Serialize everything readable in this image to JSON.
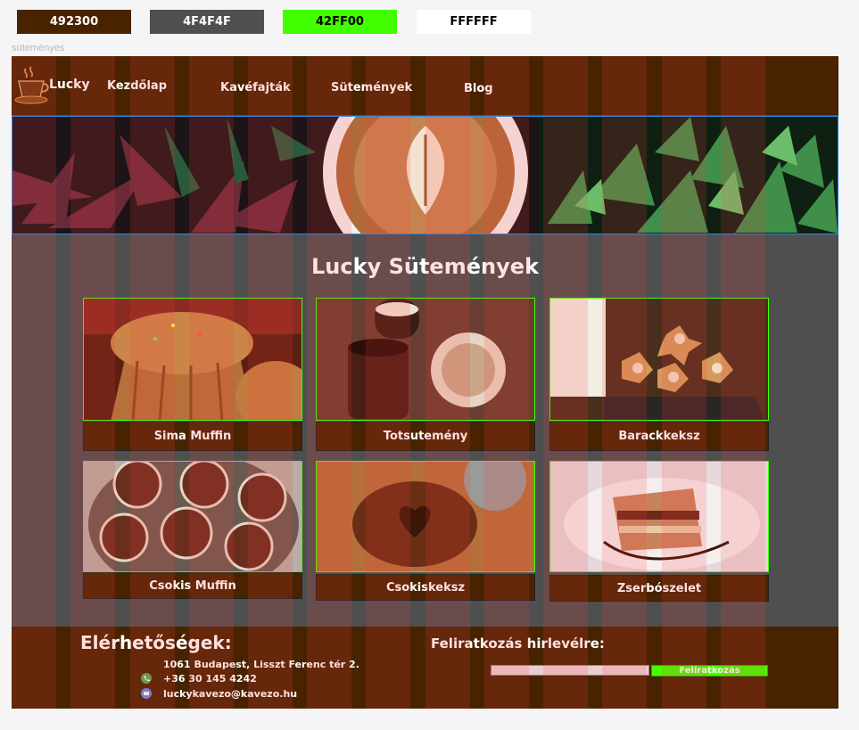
{
  "swatches": [
    {
      "label": "492300",
      "bg": "#492300",
      "fg": "#ffffff"
    },
    {
      "label": "4F4F4F",
      "bg": "#4f4f4f",
      "fg": "#ffffff"
    },
    {
      "label": "42FF00",
      "bg": "#42ff00",
      "fg": "#000000"
    },
    {
      "label": "FFFFFF",
      "bg": "#ffffff",
      "fg": "#000000"
    }
  ],
  "frame_label": "süteményes",
  "header": {
    "brand": "Lucky",
    "nav": [
      "Kezdőlap",
      "Kavéfajták",
      "Sütemények",
      "Blog"
    ]
  },
  "main": {
    "title": "Lucky Sütemények",
    "items": [
      {
        "label": "Sima Muffin",
        "icon": "muffin-photo"
      },
      {
        "label": "Totsutemény",
        "icon": "truffle-cake-photo"
      },
      {
        "label": "Barackkeksz",
        "icon": "star-cookies-photo"
      },
      {
        "label": "Csokis Muffin",
        "icon": "chocolate-muffins-photo"
      },
      {
        "label": "Csokiskeksz",
        "icon": "chocolate-cookie-photo"
      },
      {
        "label": "Zserbószelet",
        "icon": "layer-cake-photo"
      }
    ]
  },
  "footer": {
    "contact_title": "Elérhetőségek:",
    "address": "1061 Budapest, Lisszt Ferenc tér 2.",
    "phone": "+36 30 145 4242",
    "email": "luckykavezo@kavezo.hu",
    "newsletter_title": "Feliratkozás hirlevélre:",
    "subscribe_label": "Feliratkozás"
  },
  "colors": {
    "brown": "#492300",
    "gray": "#4f4f4f",
    "green": "#42ff00",
    "white": "#ffffff",
    "selection": "#1f8ef1"
  }
}
